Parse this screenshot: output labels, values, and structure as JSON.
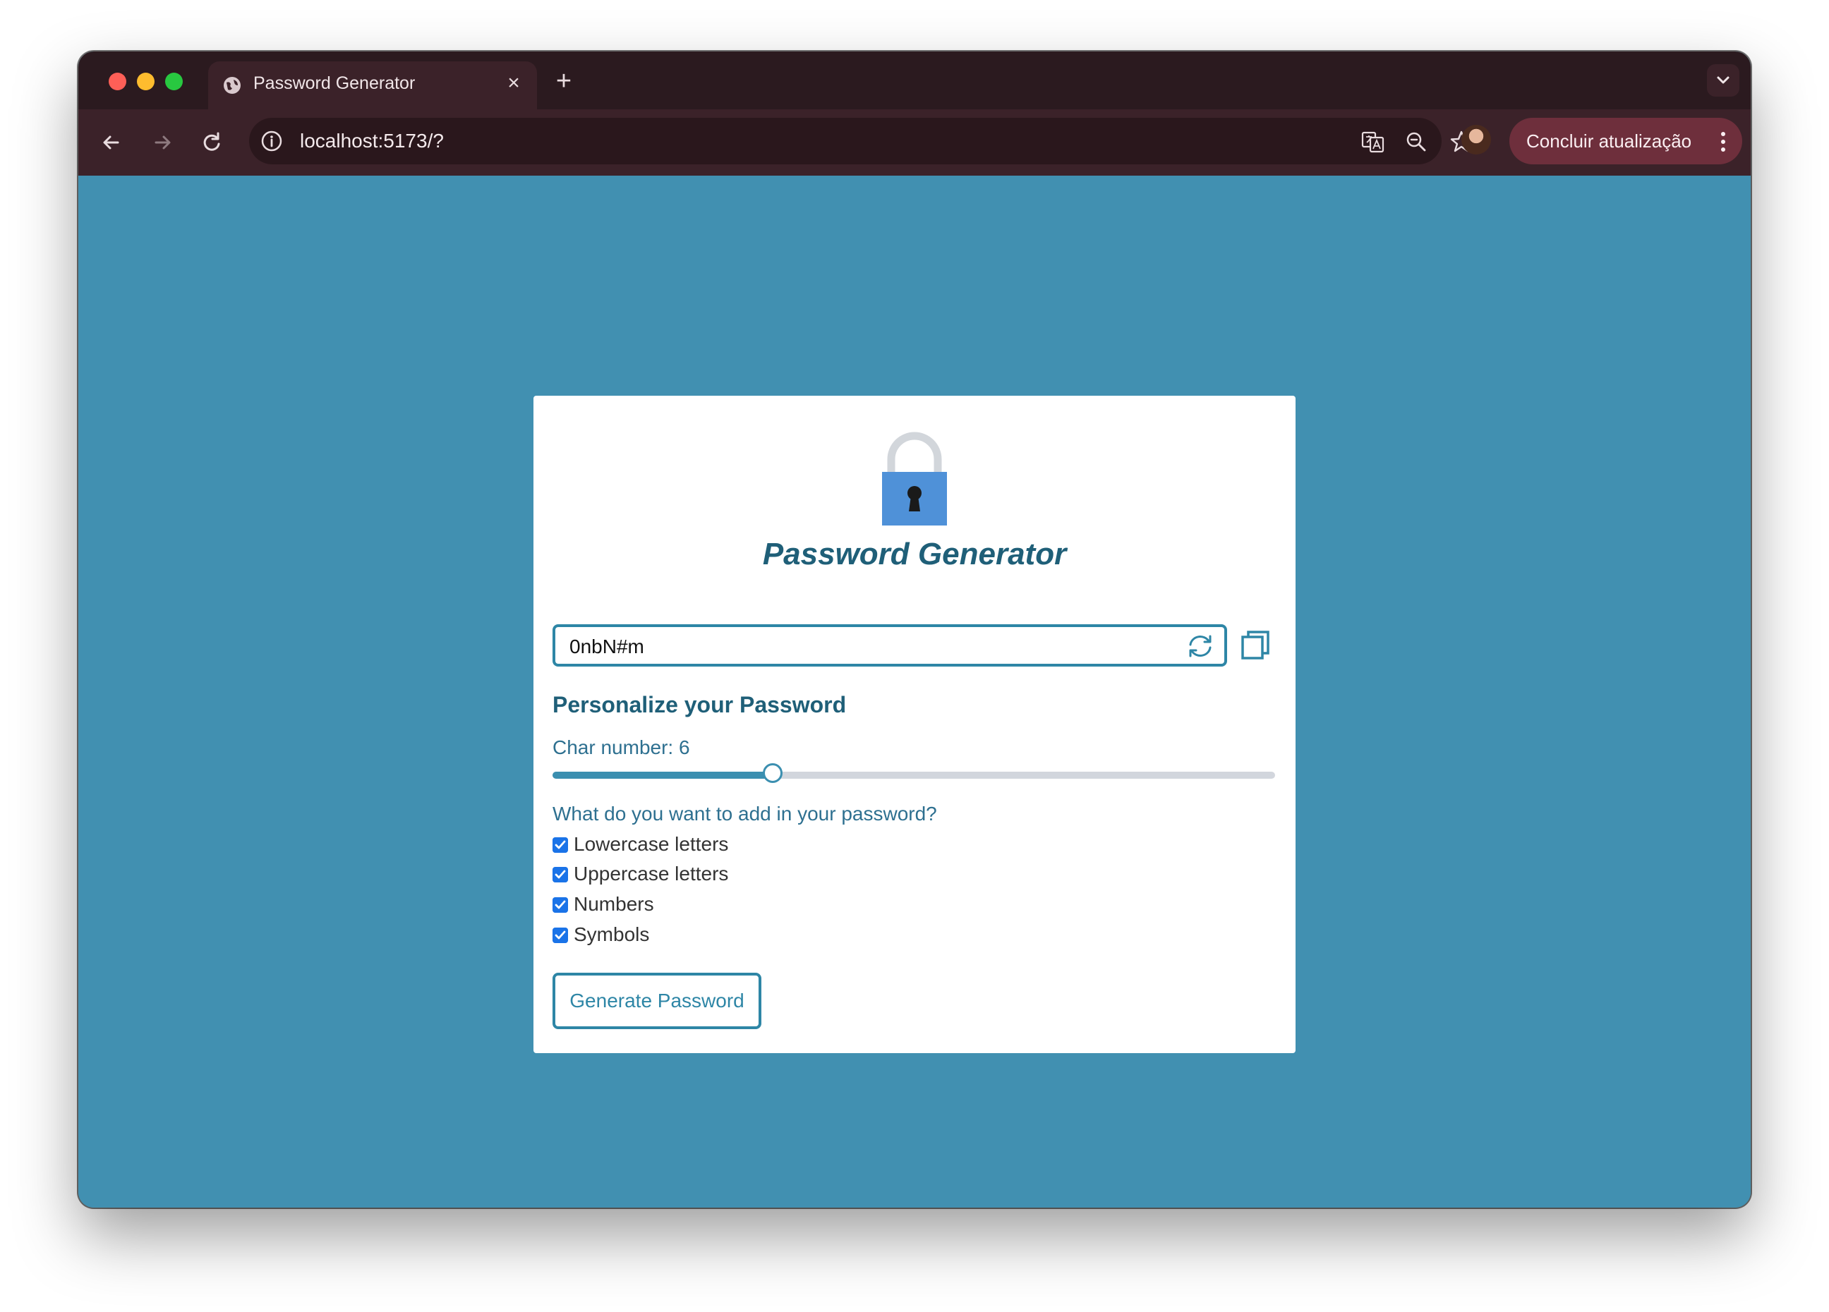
{
  "browser": {
    "tab_title": "Password Generator",
    "url": "localhost:5173/?",
    "update_button_label": "Concluir atualização",
    "accent_color": "#4190b1"
  },
  "app": {
    "title": "Password Generator",
    "password_value": "0nbN#m",
    "section_title": "Personalize your Password",
    "char_number_label": "Char number: 6",
    "char_number": 6,
    "slider_fraction": 0.305,
    "question": "What do you want to add in your password?",
    "options": [
      {
        "label": "Lowercase letters",
        "checked": true
      },
      {
        "label": "Uppercase letters",
        "checked": true
      },
      {
        "label": "Numbers",
        "checked": true
      },
      {
        "label": "Symbols",
        "checked": true
      }
    ],
    "generate_button_label": "Generate Password"
  }
}
